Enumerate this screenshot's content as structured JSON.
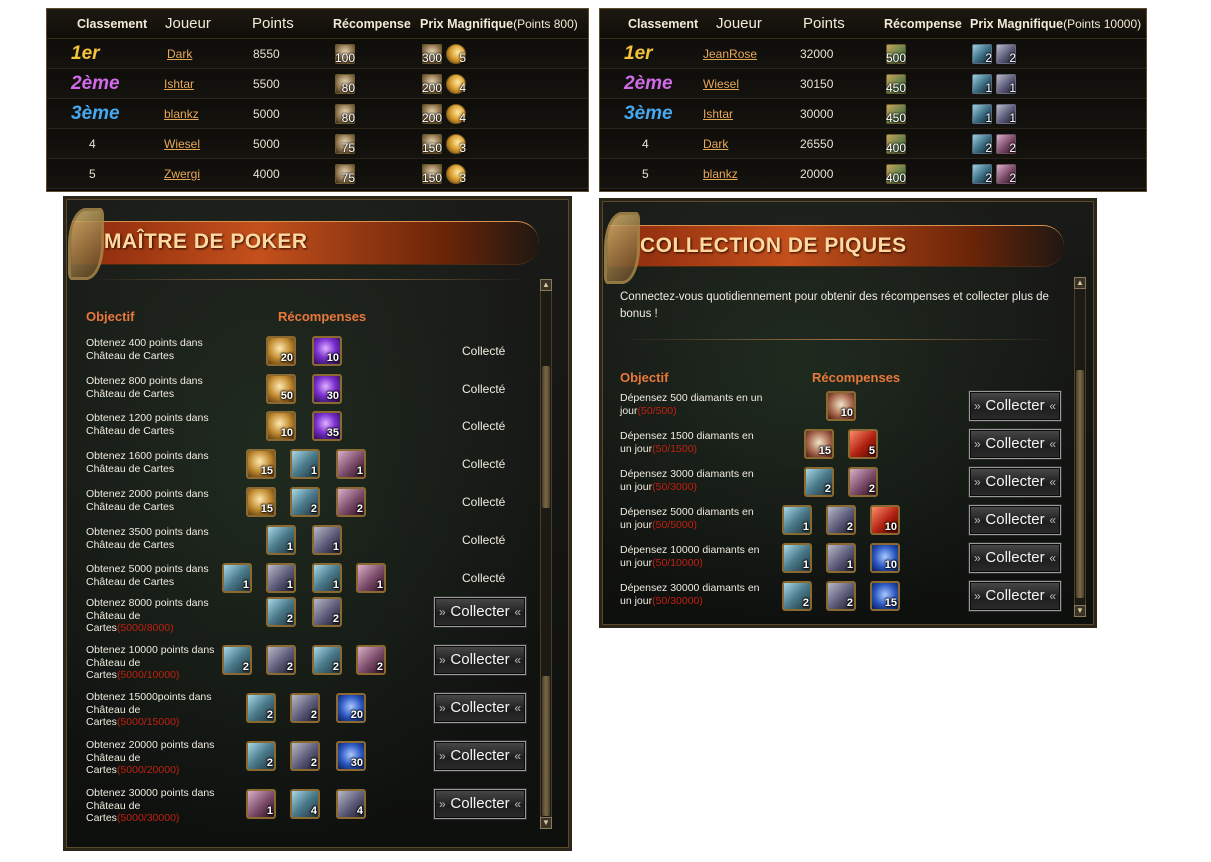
{
  "ranking_left": {
    "headers": {
      "rank": "Classement",
      "player": "Joueur",
      "points": "Points",
      "reward": "Récompense",
      "grand": "Prix Magnifique",
      "grand_note": "(Points 800)"
    },
    "rows": [
      {
        "rank": "1er",
        "player": "Dark",
        "points": "8550",
        "reward": "100",
        "grand1": "300",
        "grand2": "5"
      },
      {
        "rank": "2ème",
        "player": "Ishtar",
        "points": "5500",
        "reward": "80",
        "grand1": "200",
        "grand2": "4"
      },
      {
        "rank": "3ème",
        "player": "blankz",
        "points": "5000",
        "reward": "80",
        "grand1": "200",
        "grand2": "4"
      },
      {
        "rank": "4",
        "player": "Wiesel",
        "points": "5000",
        "reward": "75",
        "grand1": "150",
        "grand2": "3"
      },
      {
        "rank": "5",
        "player": "Zwergi",
        "points": "4000",
        "reward": "75",
        "grand1": "150",
        "grand2": "3"
      }
    ]
  },
  "ranking_right": {
    "headers": {
      "rank": "Classement",
      "player": "Joueur",
      "points": "Points",
      "reward": "Récompense",
      "grand": "Prix Magnifique",
      "grand_note": "(Points 10000)"
    },
    "rows": [
      {
        "rank": "1er",
        "player": "JeanRose",
        "points": "32000",
        "reward": "500",
        "grand1": "2",
        "grand2": "2"
      },
      {
        "rank": "2ème",
        "player": "Wiesel",
        "points": "30150",
        "reward": "450",
        "grand1": "1",
        "grand2": "1"
      },
      {
        "rank": "3ème",
        "player": "Ishtar",
        "points": "30000",
        "reward": "450",
        "grand1": "1",
        "grand2": "1"
      },
      {
        "rank": "4",
        "player": "Dark",
        "points": "26550",
        "reward": "400",
        "grand1": "2",
        "grand2": "2"
      },
      {
        "rank": "5",
        "player": "blankz",
        "points": "20000",
        "reward": "400",
        "grand1": "2",
        "grand2": "2"
      }
    ]
  },
  "poker": {
    "title": "MAÎTRE DE POKER",
    "objective_header": "Objectif",
    "rewards_header": "Récompenses",
    "collected_label": "Collecté",
    "collect_label": "Collecter",
    "rows": [
      {
        "line1": "Obtenez 400 points dans",
        "line2": "Château de Cartes",
        "line3": "",
        "progress": "",
        "status": "Collecté",
        "r1": "20",
        "r2": "10",
        "r3": "",
        "r4": ""
      },
      {
        "line1": "Obtenez 800 points dans",
        "line2": "Château de Cartes",
        "line3": "",
        "progress": "",
        "status": "Collecté",
        "r1": "50",
        "r2": "30",
        "r3": "",
        "r4": ""
      },
      {
        "line1": "Obtenez 1200 points dans",
        "line2": "Château de Cartes",
        "line3": "",
        "progress": "",
        "status": "Collecté",
        "r1": "10",
        "r2": "35",
        "r3": "",
        "r4": ""
      },
      {
        "line1": "Obtenez 1600 points dans",
        "line2": "Château de Cartes",
        "line3": "",
        "progress": "",
        "status": "Collecté",
        "r1": "15",
        "r2": "1",
        "r3": "1",
        "r4": ""
      },
      {
        "line1": "Obtenez 2000 points dans",
        "line2": "Château de Cartes",
        "line3": "",
        "progress": "",
        "status": "Collecté",
        "r1": "15",
        "r2": "2",
        "r3": "2",
        "r4": ""
      },
      {
        "line1": "Obtenez 3500 points dans",
        "line2": "Château de Cartes",
        "line3": "",
        "progress": "",
        "status": "Collecté",
        "r1": "1",
        "r2": "1",
        "r3": "",
        "r4": ""
      },
      {
        "line1": "Obtenez 5000 points dans",
        "line2": "Château de Cartes",
        "line3": "",
        "progress": "",
        "status": "Collecté",
        "r1": "1",
        "r2": "1",
        "r3": "1",
        "r4": "1"
      },
      {
        "line1": "Obtenez 8000 points dans",
        "line2": "Château de",
        "line3": "Cartes",
        "progress": "(5000/8000)",
        "status": "Collecter",
        "r1": "2",
        "r2": "2",
        "r3": "",
        "r4": ""
      },
      {
        "line1": "Obtenez 10000 points dans",
        "line2": "Château de",
        "line3": "Cartes",
        "progress": "(5000/10000)",
        "status": "Collecter",
        "r1": "2",
        "r2": "2",
        "r3": "2",
        "r4": "2"
      },
      {
        "line1": "Obtenez 15000points dans",
        "line2": "Château de",
        "line3": "Cartes",
        "progress": "(5000/15000)",
        "status": "Collecter",
        "r1": "2",
        "r2": "2",
        "r3": "20",
        "r4": ""
      },
      {
        "line1": "Obtenez 20000 points dans",
        "line2": "Château de",
        "line3": "Cartes",
        "progress": "(5000/20000)",
        "status": "Collecter",
        "r1": "2",
        "r2": "2",
        "r3": "30",
        "r4": ""
      },
      {
        "line1": "Obtenez 30000 points dans",
        "line2": "Château de",
        "line3": "Cartes",
        "progress": "(5000/30000)",
        "status": "Collecter",
        "r1": "1",
        "r2": "4",
        "r3": "4",
        "r4": ""
      }
    ]
  },
  "piques": {
    "title": "COLLECTION DE PIQUES",
    "description": "Connectez-vous quotidiennement pour obtenir des récompenses et collecter plus de bonus !",
    "objective_header": "Objectif",
    "rewards_header": "Récompenses",
    "collect_label": "Collecter",
    "rows": [
      {
        "line1": "Dépensez 500 diamants en un",
        "line2": "jour",
        "progress": "(50/500)",
        "r1": "10",
        "r2": "",
        "r3": ""
      },
      {
        "line1": "Dépensez 1500 diamants en",
        "line2": "un jour",
        "progress": "(50/1500)",
        "r1": "15",
        "r2": "5",
        "r3": ""
      },
      {
        "line1": "Dépensez 3000 diamants en",
        "line2": "un jour",
        "progress": "(50/3000)",
        "r1": "2",
        "r2": "2",
        "r3": ""
      },
      {
        "line1": "Dépensez 5000 diamants en",
        "line2": "un jour",
        "progress": "(50/5000)",
        "r1": "1",
        "r2": "2",
        "r3": "10"
      },
      {
        "line1": "Dépensez 10000 diamants en",
        "line2": "un jour",
        "progress": "(50/10000)",
        "r1": "1",
        "r2": "1",
        "r3": "10"
      },
      {
        "line1": "Dépensez 30000 diamants en",
        "line2": "un jour",
        "progress": "(50/30000)",
        "r1": "2",
        "r2": "2",
        "r3": "15"
      }
    ]
  },
  "icons": {
    "rank_reward": "house-reward-icon",
    "grand_gold": "gold-chest-icon",
    "grand_moon": "crescent-moon-icon",
    "hero_blue": "blue-hero-card-icon",
    "hero_pink": "pink-hero-card-icon",
    "scroll_up": "scroll-up-arrow-icon",
    "scroll_down": "scroll-down-arrow-icon"
  },
  "colors": {
    "accent_orange": "#e8783a",
    "progress_red": "#c02010",
    "link_orange": "#e8a85a",
    "gold_rank": "#f5c23a",
    "purple_rank": "#d06ae8",
    "blue_rank": "#47a8f0"
  }
}
